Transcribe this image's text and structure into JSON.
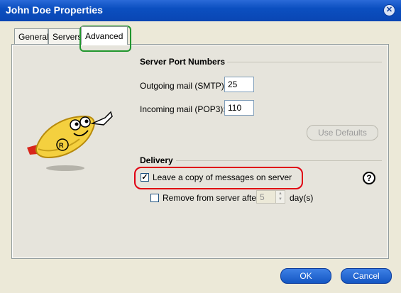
{
  "window": {
    "title": "John Doe Properties",
    "close_icon": "close-icon"
  },
  "tabs": [
    {
      "label": "General",
      "active": false
    },
    {
      "label": "Servers",
      "active": false
    },
    {
      "label": "Advanced",
      "active": true
    }
  ],
  "server_ports": {
    "heading": "Server Port Numbers",
    "outgoing_label": "Outgoing mail (SMTP):",
    "outgoing_value": "25",
    "incoming_label": "Incoming mail (POP3):",
    "incoming_value": "110",
    "use_defaults_label": "Use Defaults"
  },
  "delivery": {
    "heading": "Delivery",
    "leave_copy_label": "Leave a copy of messages on server",
    "leave_copy_checked": true,
    "remove_label": "Remove from server after",
    "remove_checked": false,
    "days_value": "5",
    "days_suffix": "day(s)",
    "help_icon": "help-icon"
  },
  "buttons": {
    "ok": "OK",
    "cancel": "Cancel"
  },
  "colors": {
    "titlebar": "#0b4fc0",
    "highlight_green": "#21962e",
    "highlight_red": "#e00012"
  }
}
